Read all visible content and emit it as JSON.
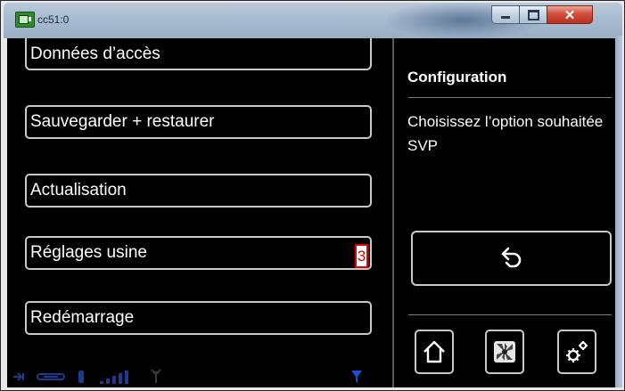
{
  "window": {
    "title": "cc51:0",
    "minimize_icon": "minimize-icon",
    "maximize_icon": "maximize-icon",
    "close_icon": "close-icon",
    "close_symbol": "✕"
  },
  "menu": {
    "items": [
      {
        "label": "Données d’accès"
      },
      {
        "label": "Sauvegarder + restaurer"
      },
      {
        "label": "Actualisation"
      },
      {
        "label": "Réglages usine"
      },
      {
        "label": "Redémarrage"
      }
    ],
    "annotation": "3"
  },
  "panel": {
    "title": "Configuration",
    "message": "Choisissez l’option souhaitée SVP",
    "back_icon": "back-arrow-icon"
  },
  "nav": {
    "home_icon": "home-icon",
    "fan_icon": "ventilation-icon",
    "settings_icon": "gears-icon"
  },
  "status": {
    "icons": [
      "connection-icon",
      "link-icon",
      "network-icon",
      "signal-bars-icon",
      "antenna-icon",
      "filter-icon"
    ]
  },
  "colors": {
    "background": "#000000",
    "button_border": "#c9c9c9",
    "text": "#ffffff",
    "annotation": "#e00000",
    "status_icons": "#1e3a8a"
  }
}
